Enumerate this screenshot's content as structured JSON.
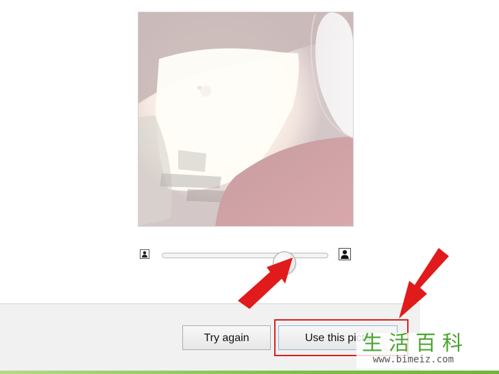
{
  "preview": {
    "alt": "webcam preview"
  },
  "slider": {
    "value_percent": 78,
    "min_icon": "person-small-icon",
    "max_icon": "person-large-icon"
  },
  "buttons": {
    "try_again": "Try again",
    "use_picture": "Use this pictu"
  },
  "watermark": {
    "chars": "生活百科",
    "url": "www.bimeiz.com"
  },
  "colors": {
    "highlight": "#d91d1d",
    "arrow": "#e11b1b",
    "watermark_green": "#4aa530"
  }
}
